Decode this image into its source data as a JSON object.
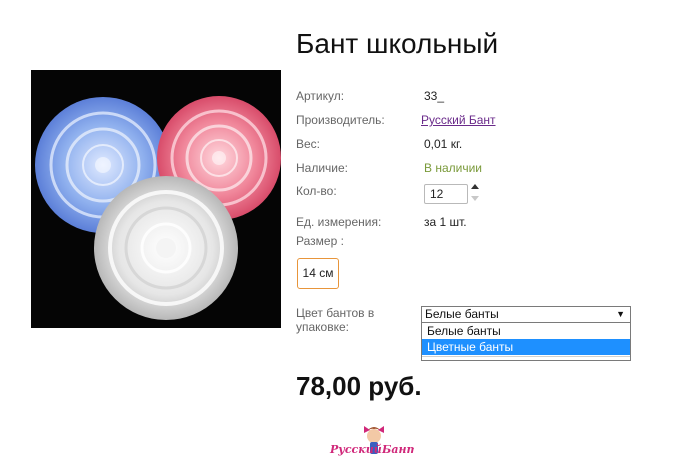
{
  "product": {
    "title": "Бант школьный",
    "price": "78,00 руб."
  },
  "specs": [
    {
      "label": "Артикул:",
      "value": "33_"
    },
    {
      "label": "Производитель:",
      "value": "Русский Бант"
    },
    {
      "label": "Вес:",
      "value": "0,01 кг."
    },
    {
      "label": "Наличие:",
      "value": "В наличии"
    },
    {
      "label": "Кол-во:",
      "value": "12"
    },
    {
      "label": "Ед. измерения:",
      "value": "за 1 шт."
    }
  ],
  "size": {
    "label": "Размер :",
    "options": [
      "14 см"
    ]
  },
  "bow_color": {
    "label": "Цвет бантов в упаковке:",
    "selected": "Белые банты",
    "options": [
      "Белые банты",
      "Цветные банты"
    ],
    "highlighted": "Цветные банты"
  },
  "logo": {
    "text_left": "Русский",
    "text_right": "Бант"
  },
  "colors": {
    "stock_green": "#7a9a3a",
    "link_purple": "#6a2a8a",
    "size_border_orange": "#e8953a",
    "dropdown_highlight": "#1e90ff",
    "logo_magenta": "#d0287a"
  }
}
